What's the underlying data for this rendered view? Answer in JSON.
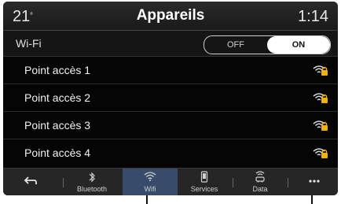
{
  "header": {
    "left_text": "21",
    "title": "Appareils",
    "time": "1:14"
  },
  "wifi": {
    "label": "Wi-Fi",
    "off_label": "OFF",
    "on_label": "ON",
    "selected": "ON"
  },
  "access_points": [
    {
      "label": "Point accès 1",
      "icon": "wifi-lock-icon"
    },
    {
      "label": "Point accès 2",
      "icon": "wifi-lock-icon"
    },
    {
      "label": "Point accès 3",
      "icon": "wifi-lock-icon"
    },
    {
      "label": "Point accès 4",
      "icon": "wifi-lock-icon"
    }
  ],
  "tabs": [
    {
      "label": "",
      "icon": "back-arrow-icon"
    },
    {
      "label": "Bluetooth",
      "icon": "bluetooth-icon"
    },
    {
      "label": "Wifi",
      "icon": "wifi-icon",
      "active": true
    },
    {
      "label": "Services",
      "icon": "phone-icon"
    },
    {
      "label": "Data",
      "icon": "car-signal-icon"
    },
    {
      "label": "",
      "icon": "more-icon"
    }
  ],
  "colors": {
    "background": "#050505",
    "bottom_bar": "#262626",
    "active_tab": "#374b6b",
    "lock_accent": "#f0b400"
  }
}
